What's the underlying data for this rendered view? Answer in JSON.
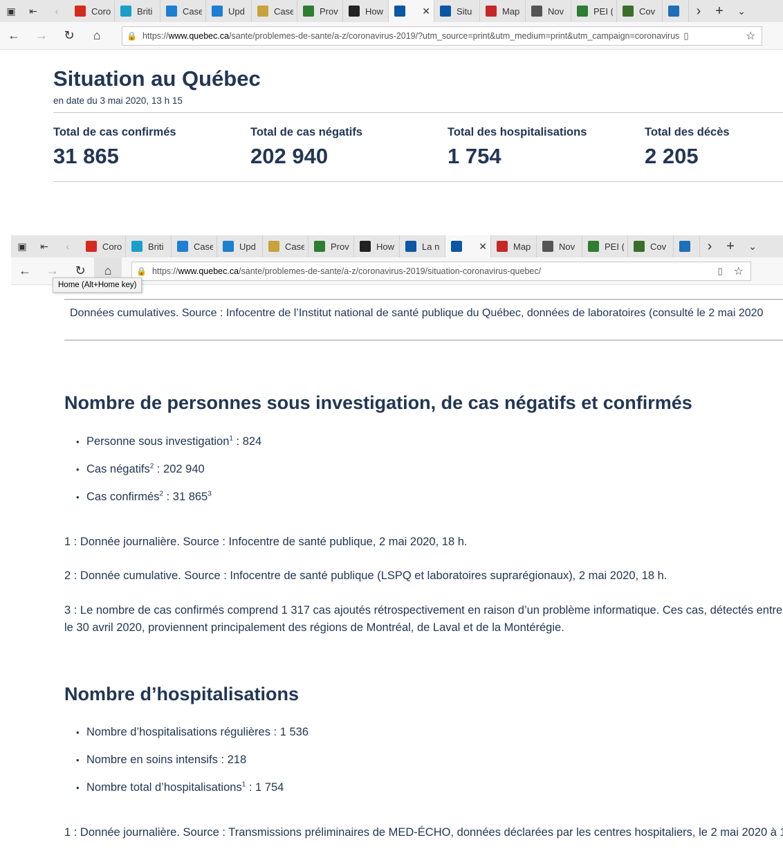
{
  "browser1": {
    "tabs": [
      {
        "label": "Coro",
        "icon": "maple-leaf-icon",
        "color": "#d52b1e"
      },
      {
        "label": "Briti",
        "icon": "bc-icon",
        "color": "#1a9fc9"
      },
      {
        "label": "Case",
        "icon": "alberta-icon",
        "color": "#1d7fd1"
      },
      {
        "label": "Upd",
        "icon": "alberta-icon",
        "color": "#1d7fd1"
      },
      {
        "label": "Case",
        "icon": "document-icon",
        "color": "#c8a23a"
      },
      {
        "label": "Prov",
        "icon": "green-box-icon",
        "color": "#2e7d32"
      },
      {
        "label": "How",
        "icon": "shield-icon",
        "color": "#222222"
      },
      {
        "label": "",
        "icon": "quebec-fleur-icon",
        "color": "#0b57a4"
      },
      {
        "label": "Situ",
        "icon": "quebec-fleur-icon",
        "color": "#0b57a4"
      },
      {
        "label": "Map",
        "icon": "ns-icon",
        "color": "#c62828"
      },
      {
        "label": "Nov",
        "icon": "envelope-icon",
        "color": "#555555"
      },
      {
        "label": "PEI (",
        "icon": "pei-icon",
        "color": "#2e7d32"
      },
      {
        "label": "Cov",
        "icon": "globe-icon",
        "color": "#3b6e2b"
      },
      {
        "label": "(",
        "icon": "nl-icon",
        "color": "#1d6fb8"
      }
    ],
    "url_prefix": "https://",
    "url_domain": "www.quebec.ca",
    "url_path": "/sante/problemes-de-sante/a-z/coronavirus-2019/?utm_source=print&utm_medium=print&utm_campaign=coronavirus"
  },
  "situation": {
    "title": "Situation au Québec",
    "date": "en date du 3 mai 2020, 13 h 15",
    "stats": [
      {
        "label": "Total de cas confirmés",
        "value": "31 865"
      },
      {
        "label": "Total de cas négatifs",
        "value": "202 940"
      },
      {
        "label": "Total des hospitalisations",
        "value": "1 754"
      },
      {
        "label": "Total des décès",
        "value": "2 205"
      }
    ]
  },
  "browser2": {
    "tabs": [
      {
        "label": "Coro",
        "icon": "maple-leaf-icon",
        "color": "#d52b1e"
      },
      {
        "label": "Briti",
        "icon": "bc-icon",
        "color": "#1a9fc9"
      },
      {
        "label": "Case",
        "icon": "alberta-icon",
        "color": "#1d7fd1"
      },
      {
        "label": "Upd",
        "icon": "alberta-icon",
        "color": "#1d7fd1"
      },
      {
        "label": "Case",
        "icon": "document-icon",
        "color": "#c8a23a"
      },
      {
        "label": "Prov",
        "icon": "green-box-icon",
        "color": "#2e7d32"
      },
      {
        "label": "How",
        "icon": "shield-icon",
        "color": "#222222"
      },
      {
        "label": "La n",
        "icon": "quebec-fleur-icon",
        "color": "#0b57a4"
      },
      {
        "label": "",
        "icon": "quebec-fleur-icon",
        "color": "#0b57a4"
      },
      {
        "label": "Map",
        "icon": "ns-icon",
        "color": "#c62828"
      },
      {
        "label": "Nov",
        "icon": "envelope-icon",
        "color": "#555555"
      },
      {
        "label": "PEI (",
        "icon": "pei-icon",
        "color": "#2e7d32"
      },
      {
        "label": "Cov",
        "icon": "globe-icon",
        "color": "#3b6e2b"
      },
      {
        "label": "(",
        "icon": "nl-icon",
        "color": "#1d6fb8"
      }
    ],
    "url_prefix": "https://",
    "url_domain": "www.quebec.ca",
    "url_path": "/sante/problemes-de-sante/a-z/coronavirus-2019/situation-coronavirus-quebec/",
    "tooltip": "Home (Alt+Home key)"
  },
  "content": {
    "cumulative_note": "Données cumulatives. Source : Infocentre de l’Institut national de santé publique du Québec, données de laboratoires (consulté le 2 mai 2020",
    "section1": {
      "title": "Nombre de personnes sous investigation, de cas négatifs et confirmés",
      "items": [
        {
          "label": "Personne sous investigation",
          "sup": "1",
          "value": " : 824",
          "sup2": ""
        },
        {
          "label": "Cas négatifs",
          "sup": "2",
          "value": " : 202 940",
          "sup2": ""
        },
        {
          "label": "Cas confirmés",
          "sup": "2",
          "value": " : 31 865",
          "sup2": "3"
        }
      ],
      "notes": [
        "1 : Donnée journalière. Source : Infocentre de santé publique, 2 mai 2020, 18 h.",
        "2 : Donnée cumulative. Source : Infocentre de santé publique (LSPQ et laboratoires suprarégionaux), 2 mai 2020, 18 h.",
        "3 : Le nombre de cas confirmés comprend 1 317 cas ajoutés rétrospectivement en raison d’un problème informatique. Ces cas, détectés entre",
        "le 30 avril 2020, proviennent principalement des régions de Montréal, de Laval et de la Montérégie."
      ]
    },
    "section2": {
      "title": "Nombre d’hospitalisations",
      "items": [
        {
          "label": "Nombre d’hospitalisations régulières",
          "sup": "",
          "value": " : 1 536",
          "sup2": ""
        },
        {
          "label": "Nombre en soins intensifs",
          "sup": "",
          "value": " : 218",
          "sup2": ""
        },
        {
          "label": "Nombre total d’hospitalisations",
          "sup": "1",
          "value": " : 1 754",
          "sup2": ""
        }
      ],
      "notes": [
        "1 : Donnée journalière. Source : Transmissions préliminaires de MED-ÉCHO, données déclarées par les centres hospitaliers, le 2 mai 2020 à 1"
      ]
    }
  }
}
